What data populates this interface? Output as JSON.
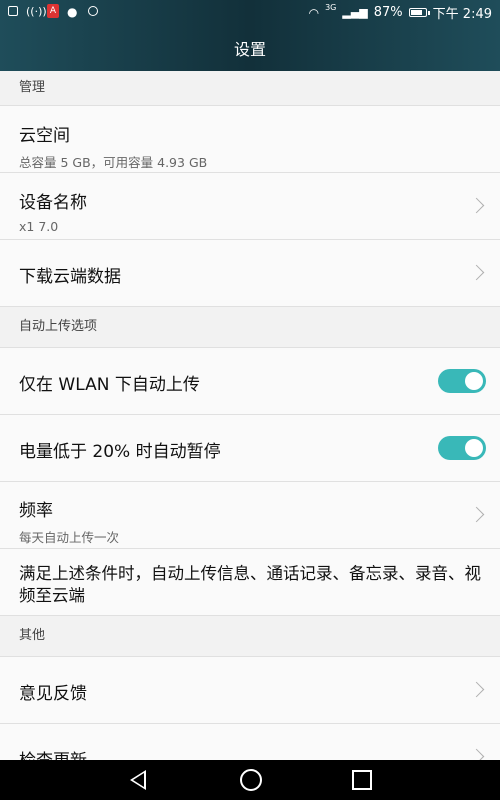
{
  "status": {
    "battery": "87%",
    "time": "下午 2:49",
    "network": "3G",
    "left_icons": [
      "image-icon",
      "wifi-signal-icon",
      "app-notification-icon",
      "location-icon",
      "chat-icon"
    ]
  },
  "header": {
    "title": "设置"
  },
  "sections": [
    {
      "header": "管理",
      "items": [
        {
          "title": "云空间",
          "sub": "总容量 5 GB，可用容量 4.93 GB"
        },
        {
          "title": "设备名称",
          "sub": "x1 7.0"
        },
        {
          "title": "下载云端数据"
        }
      ]
    },
    {
      "header": "自动上传选项",
      "items": [
        {
          "title": "仅在 WLAN 下自动上传"
        },
        {
          "title": "电量低于 20% 时自动暂停"
        },
        {
          "title": "频率",
          "sub": "每天自动上传一次"
        },
        {
          "title": "满足上述条件时，自动上传信息、通话记录、备忘录、录音、视频至云端"
        }
      ]
    },
    {
      "header": "其他",
      "items": [
        {
          "title": "意见反馈"
        },
        {
          "title": "检查更新"
        }
      ]
    }
  ],
  "nav": {
    "back": "back-icon",
    "home": "home-icon",
    "recent": "recent-apps-icon"
  },
  "colors": {
    "accent": "#39b8b8",
    "topbar": "#1f4d5a"
  }
}
